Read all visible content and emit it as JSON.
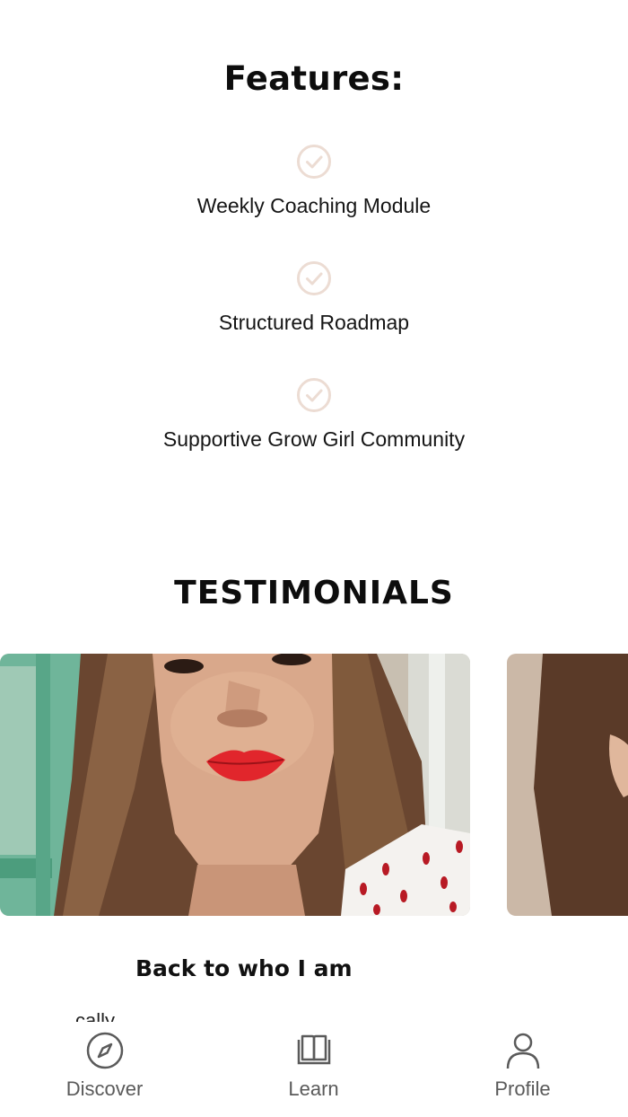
{
  "features": {
    "title": "Features:",
    "items": [
      {
        "label": "Weekly Coaching Module",
        "icon": "check-circle-icon"
      },
      {
        "label": "Structured Roadmap",
        "icon": "check-circle-icon"
      },
      {
        "label": "Supportive Grow Girl Community",
        "icon": "check-circle-icon"
      }
    ],
    "check_color": "#ecdcd3"
  },
  "testimonials": {
    "title": "TESTIMONIALS",
    "cards": [
      {
        "title": "Back to who I am",
        "snippet": "cally"
      }
    ]
  },
  "tabbar": {
    "tabs": [
      {
        "label": "Discover",
        "icon": "compass-icon"
      },
      {
        "label": "Learn",
        "icon": "book-icon"
      },
      {
        "label": "Profile",
        "icon": "person-icon"
      }
    ]
  }
}
